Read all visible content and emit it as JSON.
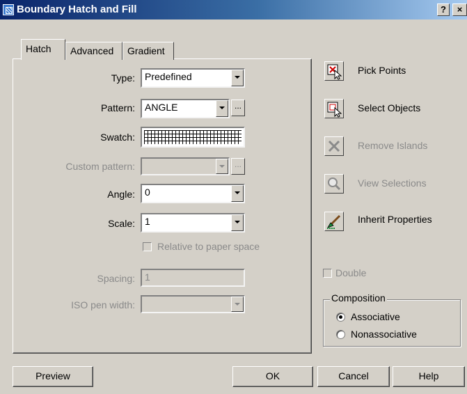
{
  "window": {
    "title": "Boundary Hatch and Fill",
    "help_glyph": "?",
    "close_glyph": "×"
  },
  "tabs": [
    {
      "label": "Hatch",
      "active": true
    },
    {
      "label": "Advanced",
      "active": false
    },
    {
      "label": "Gradient",
      "active": false
    }
  ],
  "hatch": {
    "type": {
      "label": "Type:",
      "value": "Predefined"
    },
    "pattern": {
      "label": "Pattern:",
      "value": "ANGLE",
      "browse": "..."
    },
    "swatch": {
      "label": "Swatch:"
    },
    "custom_pattern": {
      "label": "Custom pattern:",
      "value": "",
      "browse": "...",
      "disabled": true
    },
    "angle": {
      "label": "Angle:",
      "value": "0"
    },
    "scale": {
      "label": "Scale:",
      "value": "1"
    },
    "relative_to_paper": {
      "label": "Relative to paper space",
      "checked": false,
      "disabled": true
    },
    "spacing": {
      "label": "Spacing:",
      "value": "1",
      "disabled": true
    },
    "iso_pen_width": {
      "label": "ISO pen width:",
      "value": "",
      "disabled": true
    }
  },
  "actions": {
    "pick_points": {
      "label": "Pick Points",
      "icon": "pick-points-icon"
    },
    "select_objects": {
      "label": "Select Objects",
      "icon": "select-objects-icon"
    },
    "remove_islands": {
      "label": "Remove Islands",
      "icon": "remove-islands-icon",
      "disabled": true
    },
    "view_selections": {
      "label": "View Selections",
      "icon": "magnifier-icon",
      "disabled": true
    },
    "inherit_properties": {
      "label": "Inherit Properties",
      "icon": "inherit-brush-icon"
    }
  },
  "double": {
    "label": "Double",
    "checked": false,
    "disabled": true
  },
  "composition": {
    "title": "Composition",
    "associative": {
      "label": "Associative",
      "selected": true
    },
    "nonassociative": {
      "label": "Nonassociative",
      "selected": false
    }
  },
  "buttons": {
    "preview": "Preview",
    "ok": "OK",
    "cancel": "Cancel",
    "help": "Help"
  },
  "colors": {
    "titlebar_start": "#0a246a",
    "titlebar_end": "#a6caf0",
    "face": "#d4d0c8",
    "disabled_text": "#8a8a8a"
  }
}
